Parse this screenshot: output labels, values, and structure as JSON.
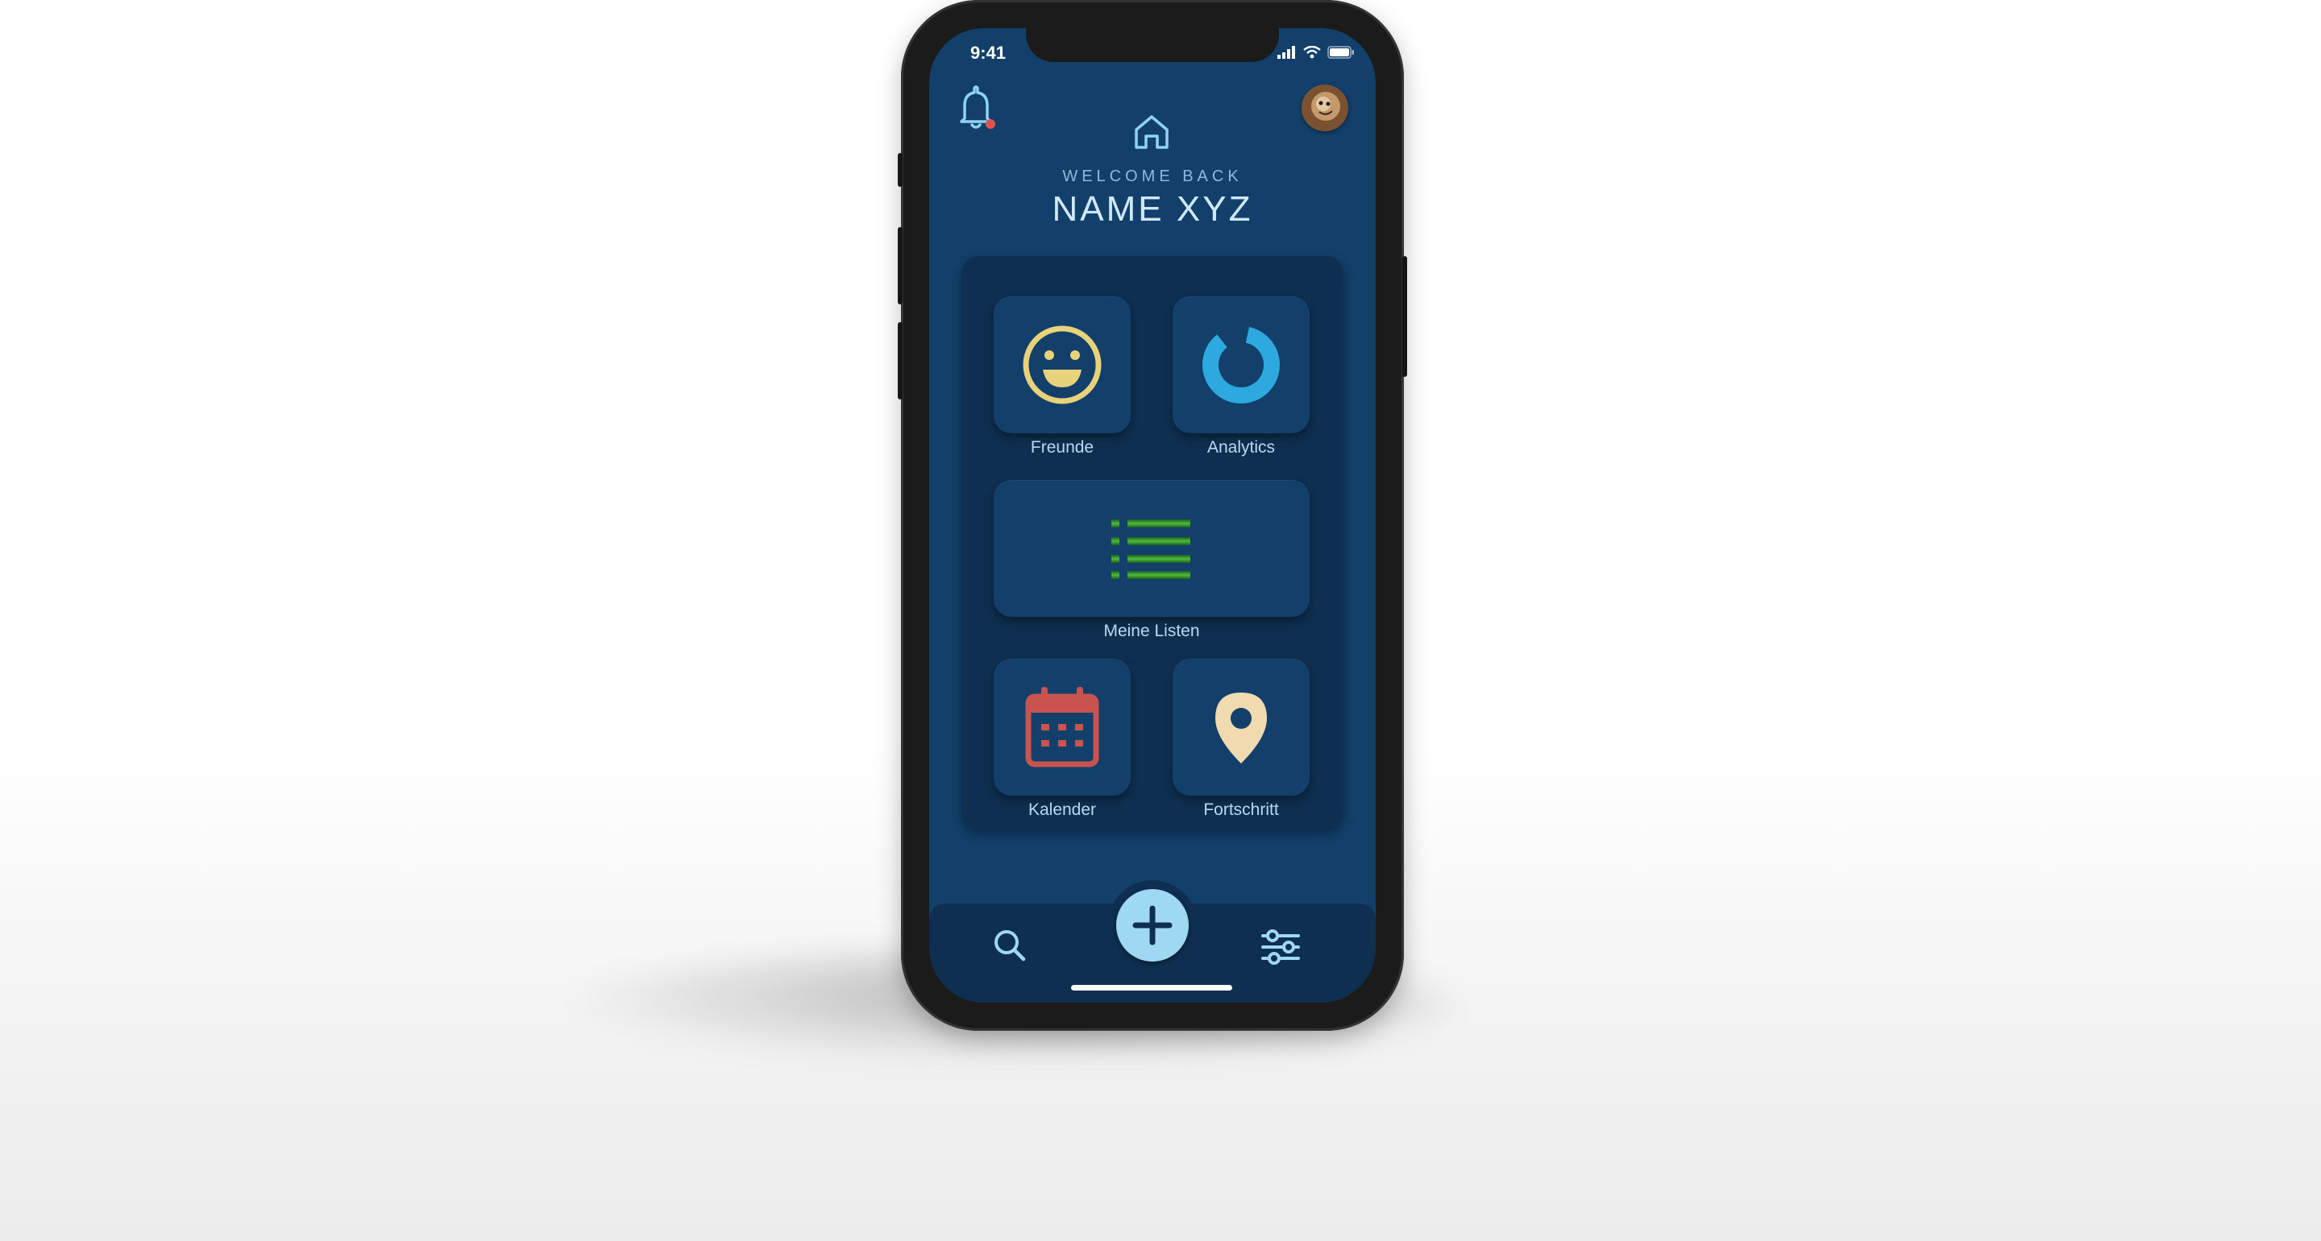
{
  "status_bar": {
    "time": "9:41",
    "icons": [
      "signal-icon",
      "wifi-icon",
      "battery-icon"
    ]
  },
  "header": {
    "notification_icon": "bell-icon",
    "home_icon": "home-icon",
    "avatar": "user-avatar",
    "welcome": "WELCOME BACK",
    "name": "NAME XYZ"
  },
  "tiles": {
    "freunde": {
      "label": "Freunde",
      "icon": "smiley-icon"
    },
    "analytics": {
      "label": "Analytics",
      "icon": "donut-chart-icon"
    },
    "listen": {
      "label": "Meine Listen",
      "icon": "list-icon"
    },
    "kalender": {
      "label": "Kalender",
      "icon": "calendar-icon"
    },
    "fortschritt": {
      "label": "Fortschritt",
      "icon": "map-pin-icon"
    }
  },
  "bottom_nav": {
    "search_icon": "search-icon",
    "add_icon": "plus-icon",
    "settings_icon": "sliders-icon"
  },
  "colors": {
    "screen_bg": "#12406b",
    "panel_bg": "#0e2f50",
    "accent_light_blue": "#9fd8f1",
    "smiley_yellow": "#e8d27a",
    "analytics_blue": "#2ea9e0",
    "list_green": "#3fa33b",
    "calendar_red": "#c9544f",
    "pin_beige": "#f1d9b0",
    "notification_dot": "#e2524f"
  }
}
